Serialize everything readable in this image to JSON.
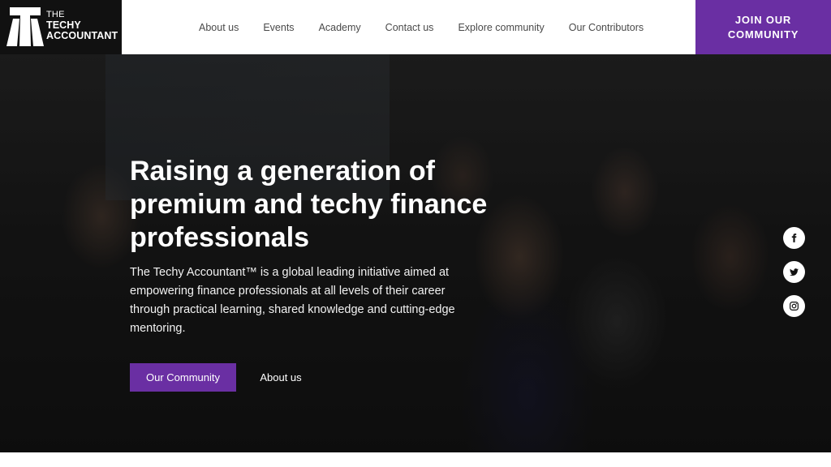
{
  "brand": {
    "line1": "THE",
    "line2": "TECHY",
    "line3": "ACCOUNTANT",
    "accent_color": "#6a2fa3"
  },
  "nav": {
    "items": [
      {
        "label": "About us"
      },
      {
        "label": "Events"
      },
      {
        "label": "Academy"
      },
      {
        "label": "Contact us"
      },
      {
        "label": "Explore community"
      },
      {
        "label": "Our Contributors"
      }
    ]
  },
  "join_button": {
    "line1": "JOIN OUR",
    "line2": "COMMUNITY"
  },
  "hero": {
    "title": "Raising a generation of premium and techy finance professionals",
    "description": "The Techy Accountant™ is a global leading initiative aimed at empowering finance professionals at all levels of their career through practical learning, shared knowledge and cutting-edge mentoring.",
    "primary_button": "Our Community",
    "secondary_button": "About us"
  },
  "social": {
    "icons": [
      "facebook-icon",
      "twitter-icon",
      "instagram-icon"
    ]
  }
}
